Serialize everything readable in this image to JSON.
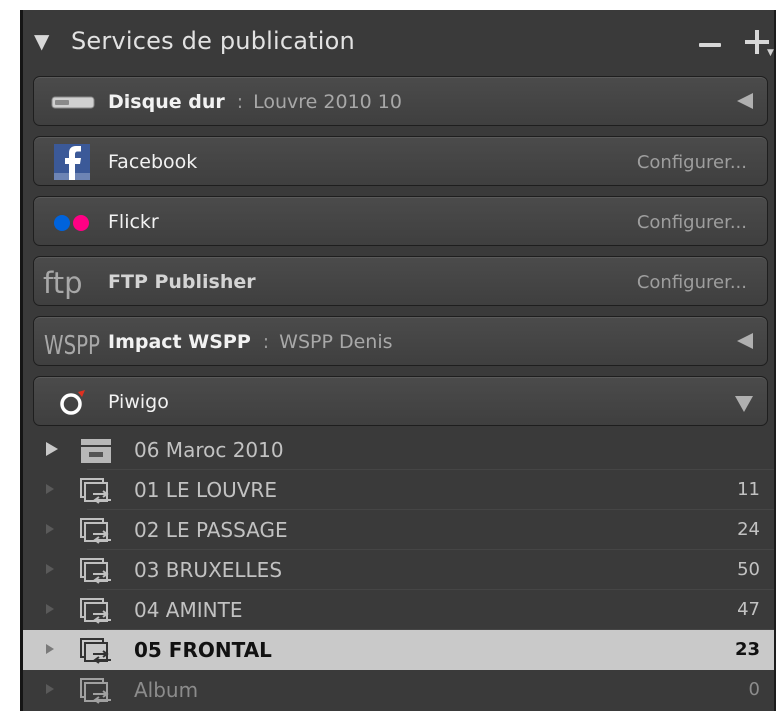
{
  "header": {
    "title": "Services de publication",
    "collapse_icon": "disclosure-triangle-down-icon",
    "minus_icon": "minus-icon",
    "plus_icon": "plus-menu-icon"
  },
  "services": [
    {
      "icon": "hard-drive-icon",
      "name": "Disque dur",
      "separator": ":",
      "subtitle": "Louvre 2010 10",
      "action": "collapse-left-arrow"
    },
    {
      "icon": "facebook-icon",
      "name": "Facebook",
      "action_label": "Configurer..."
    },
    {
      "icon": "flickr-icon",
      "name": "Flickr",
      "action_label": "Configurer..."
    },
    {
      "icon": "ftp-icon",
      "icon_text": "ftp",
      "name": "FTP Publisher",
      "action_label": "Configurer..."
    },
    {
      "icon": "wspp-icon",
      "icon_text": "WSPP",
      "name": "Impact WSPP",
      "separator": ":",
      "subtitle": "WSPP Denis",
      "action": "collapse-left-arrow"
    },
    {
      "icon": "piwigo-icon",
      "name": "Piwigo",
      "action": "expand-down-arrow"
    }
  ],
  "collections": [
    {
      "label": "06 Maroc 2010",
      "count": "",
      "type": "collection-set",
      "expander": "triangle-right-icon"
    },
    {
      "label": "01 LE LOUVRE",
      "count": "11",
      "type": "published-collection"
    },
    {
      "label": "02 LE PASSAGE",
      "count": "24",
      "type": "published-collection"
    },
    {
      "label": "03 BRUXELLES",
      "count": "50",
      "type": "published-collection"
    },
    {
      "label": "04 AMINTE",
      "count": "47",
      "type": "published-collection"
    },
    {
      "label": "05 FRONTAL",
      "count": "23",
      "type": "published-collection",
      "selected": true
    },
    {
      "label": "Album",
      "count": "0",
      "type": "published-collection"
    }
  ],
  "colors": {
    "panel_bg": "#3a3a3a",
    "selected_row": "#c9c9c9",
    "facebook_blue": "#3b5998",
    "flickr_blue": "#0063dc",
    "flickr_pink": "#ff0084",
    "piwigo_red": "#e03020"
  }
}
